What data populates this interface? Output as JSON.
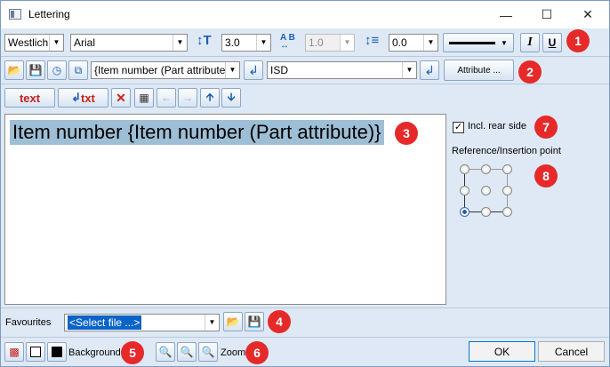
{
  "window": {
    "title": "Lettering"
  },
  "toolbar1": {
    "style_value": "Westlich",
    "font_value": "Arial",
    "height_value": "3.0",
    "spacing_value": "1.0",
    "line_spacing_value": "0.0",
    "italic_label": "I",
    "underline_label": "U"
  },
  "toolbar2": {
    "attribute_value": "{Item number (Part attribute)}",
    "standard_value": "ISD",
    "attribute_button": "Attribute ..."
  },
  "toolbar3": {
    "text_btn_label": "text",
    "text_btn2_label": "txt"
  },
  "editor": {
    "content": "Item number {Item number (Part attribute)}"
  },
  "right_panel": {
    "rear_side_label": "Incl. rear side",
    "rear_side_checked": true,
    "reference_label": "Reference/Insertion point",
    "selected_point": "bottom-left"
  },
  "favourites": {
    "label": "Favourites",
    "select_value": "<Select file ...>"
  },
  "bottom": {
    "background_label": "Background",
    "zoom_label": "Zoom",
    "ok_label": "OK",
    "cancel_label": "Cancel"
  },
  "badges": [
    "1",
    "2",
    "3",
    "4",
    "5",
    "6",
    "7",
    "8"
  ],
  "colors": {
    "badge": "#e62929",
    "accent": "#1b5fb3",
    "selection": "#9ebed6"
  }
}
